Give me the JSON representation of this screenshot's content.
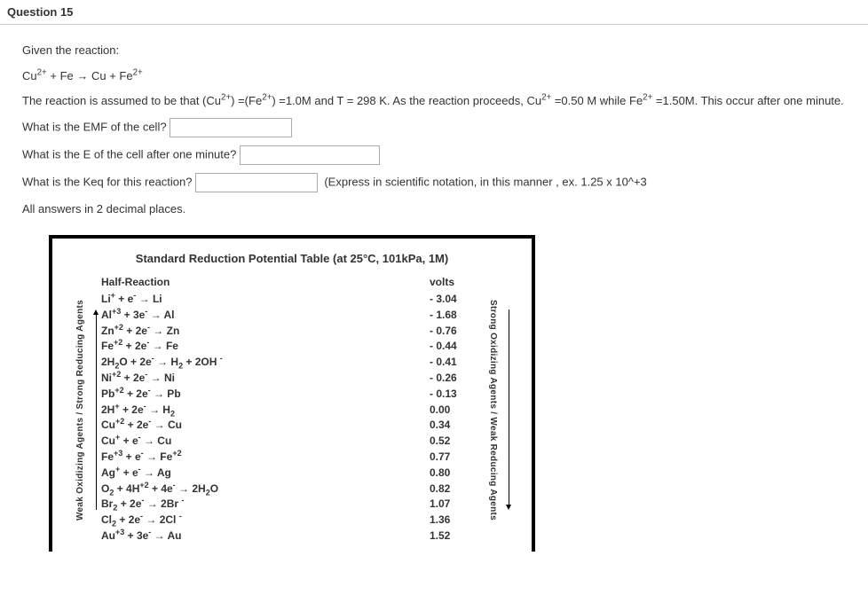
{
  "question": {
    "title": "Question 15",
    "given": "Given the reaction:",
    "reaction_eq": "Cu__SUP2+__ + Fe → Cu + Fe__SUP2+__",
    "assumption": "The reaction is assumed to be that  (Cu__SUP2+__) =(Fe__SUP2+__) =1.0M  and T = 298 K. As the reaction proceeds, Cu__SUP2+__ =0.50 M while  Fe__SUP2+__ =1.50M. This occur after one minute.",
    "q1": "What is the EMF of the cell?",
    "q2": "What is the E of the cell after one minute?",
    "q3": "What is the Keq  for this reaction?",
    "q3_note": "(Express in scientific notation, in this manner , ex. 1.25 x 10^+3",
    "note": "All answers in 2 decimal places."
  },
  "table": {
    "title": "Standard Reduction Potential Table (at 25°C, 101kPa, 1M)",
    "hdr_rx": "Half-Reaction",
    "hdr_v": "volts",
    "rows": [
      {
        "rx": "Li__SUP+__ + e__SUP-__ → Li",
        "v": "- 3.04"
      },
      {
        "rx": "Al__SUP+3__ + 3e__SUP-__ → Al",
        "v": "- 1.68"
      },
      {
        "rx": "Zn__SUP+2__ + 2e__SUP-__ → Zn",
        "v": "- 0.76"
      },
      {
        "rx": "Fe__SUP+2__ + 2e__SUP-__ → Fe",
        "v": "- 0.44"
      },
      {
        "rx": "2H__SUB2__O + 2e__SUP-__ → H__SUB2__ + 2OH __SUP-__",
        "v": "- 0.41"
      },
      {
        "rx": "Ni__SUP+2__ + 2e__SUP-__ → Ni",
        "v": "- 0.26"
      },
      {
        "rx": "Pb__SUP+2__ + 2e__SUP-__ → Pb",
        "v": "- 0.13"
      },
      {
        "rx": "2H__SUP+__ + 2e__SUP-__ → H__SUB2__",
        "v": "0.00"
      },
      {
        "rx": "Cu__SUP+2__ + 2e__SUP-__ → Cu",
        "v": "0.34"
      },
      {
        "rx": "Cu__SUP+__ + e__SUP-__ → Cu",
        "v": "0.52"
      },
      {
        "rx": "Fe__SUP+3__ + e__SUP-__ → Fe__SUP+2__",
        "v": "0.77"
      },
      {
        "rx": "Ag__SUP+__ + e__SUP-__ → Ag",
        "v": "0.80"
      },
      {
        "rx": "O__SUB2__ + 4H__SUP+2__ + 4e__SUP-__ → 2H__SUB2__O",
        "v": "0.82"
      },
      {
        "rx": "Br__SUB2__ + 2e__SUP-__ → 2Br __SUP-__",
        "v": "1.07"
      },
      {
        "rx": "Cl__SUB2__ + 2e__SUP-__ → 2Cl __SUP-__",
        "v": "1.36"
      },
      {
        "rx": "Au__SUP+3__ + 3e__SUP-__ → Au",
        "v": "1.52"
      }
    ],
    "left_label": "Weak Oxidizing Agents / Strong Reducing Agents",
    "right_label": "Strong Oxidizing Agents / Weak Reducing Agents"
  }
}
